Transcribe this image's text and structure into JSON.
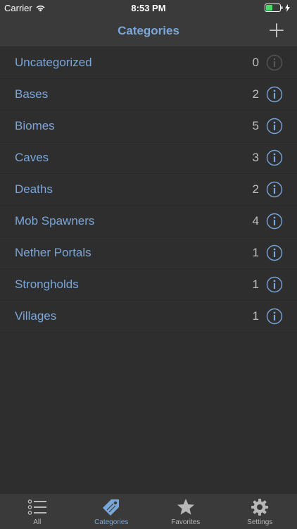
{
  "status_bar": {
    "carrier": "Carrier",
    "time": "8:53 PM"
  },
  "nav": {
    "title": "Categories"
  },
  "categories": [
    {
      "label": "Uncategorized",
      "count": "0",
      "enabled": false
    },
    {
      "label": "Bases",
      "count": "2",
      "enabled": true
    },
    {
      "label": "Biomes",
      "count": "5",
      "enabled": true
    },
    {
      "label": "Caves",
      "count": "3",
      "enabled": true
    },
    {
      "label": "Deaths",
      "count": "2",
      "enabled": true
    },
    {
      "label": "Mob Spawners",
      "count": "4",
      "enabled": true
    },
    {
      "label": "Nether Portals",
      "count": "1",
      "enabled": true
    },
    {
      "label": "Strongholds",
      "count": "1",
      "enabled": true
    },
    {
      "label": "Villages",
      "count": "1",
      "enabled": true
    }
  ],
  "tabs": [
    {
      "label": "All",
      "icon": "list-icon",
      "active": false
    },
    {
      "label": "Categories",
      "icon": "tag-icon",
      "active": true
    },
    {
      "label": "Favorites",
      "icon": "star-icon",
      "active": false
    },
    {
      "label": "Settings",
      "icon": "gear-icon",
      "active": false
    }
  ],
  "colors": {
    "accent": "#7aa6da",
    "background": "#2e2e2e",
    "bar": "#3a3a3a"
  }
}
